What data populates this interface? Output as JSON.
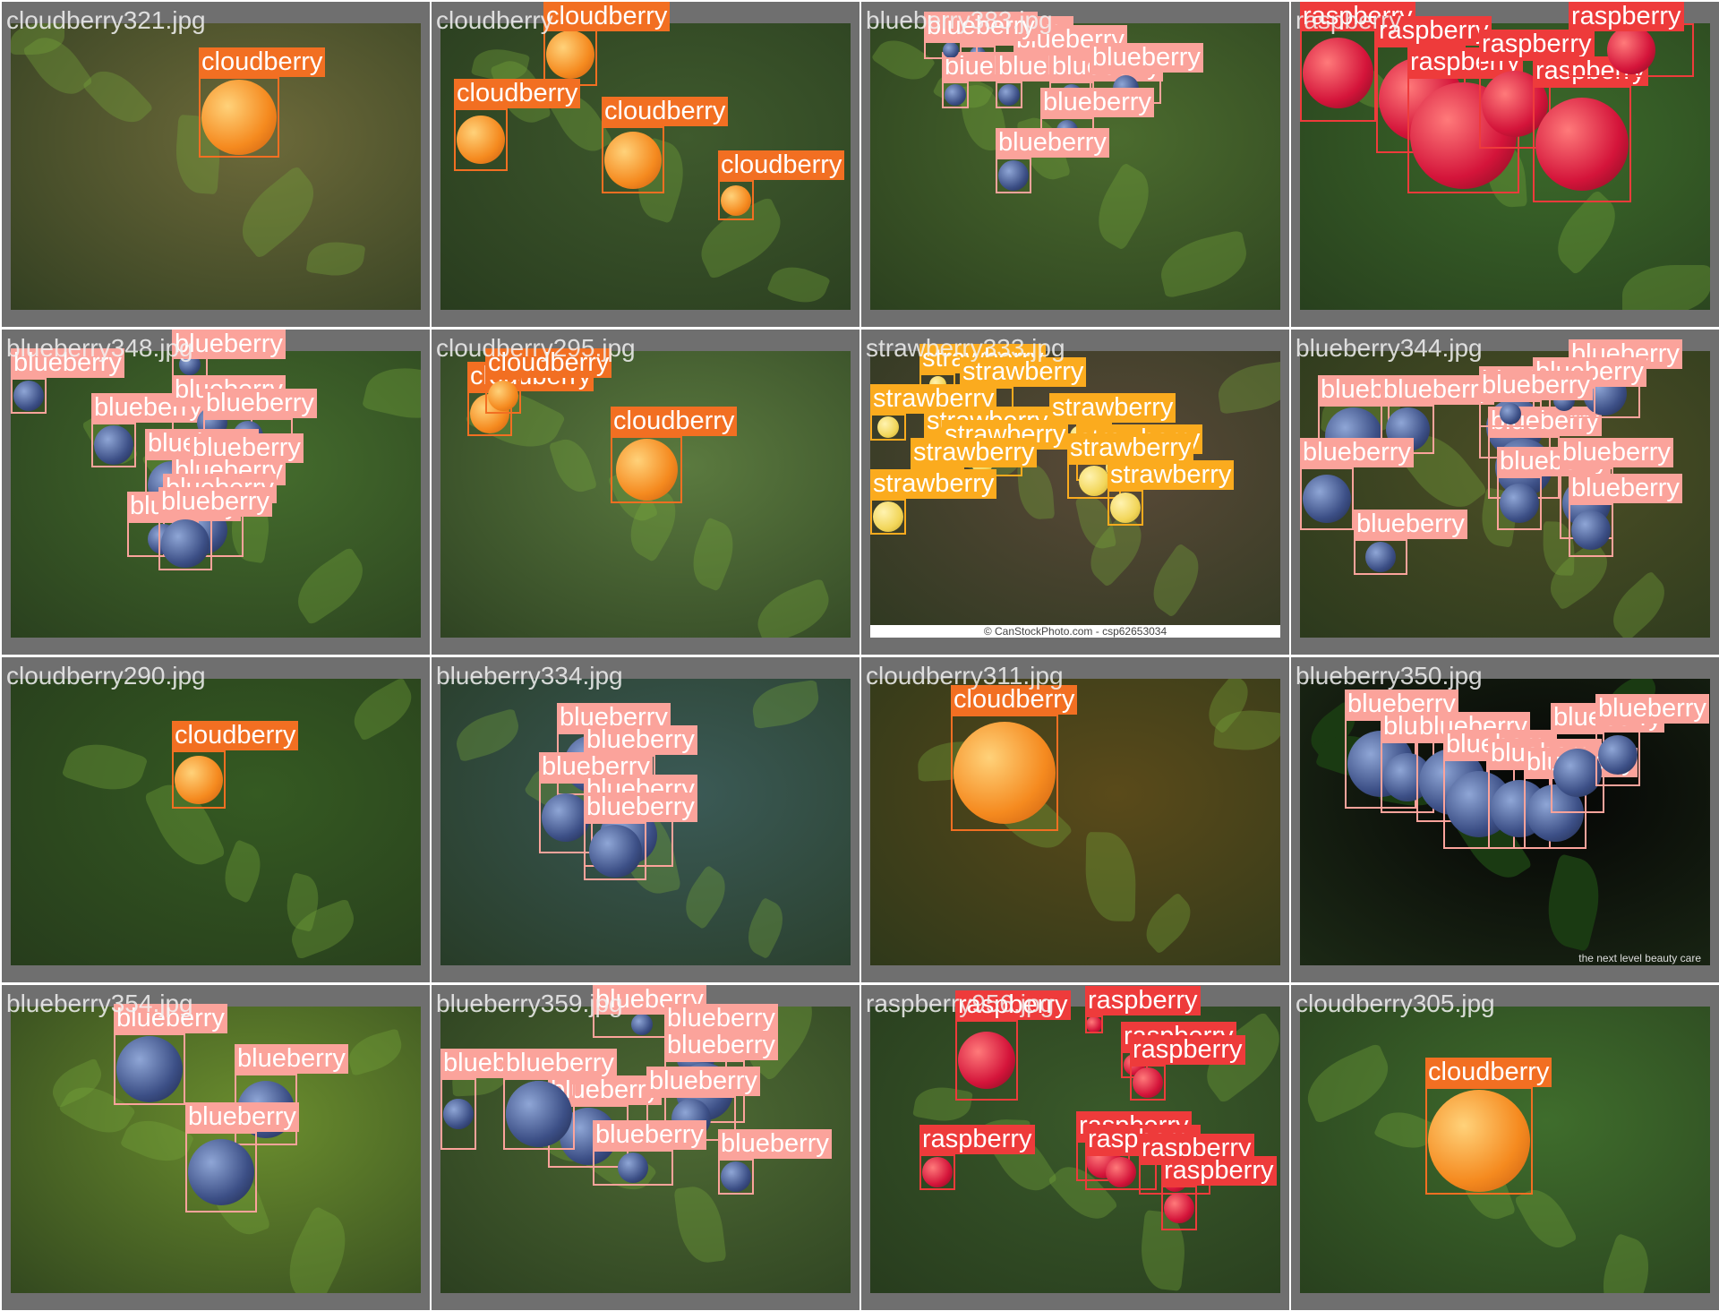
{
  "colors": {
    "cloudberry": "#f26f22",
    "blueberry": "#fba39b",
    "raspberry": "#ee3b3b",
    "strawberry": "#fbab1e",
    "tile_bg": "#6f6f6f"
  },
  "tiles": [
    {
      "file": "cloudberry321.jpg",
      "bg": "#6d6a3a",
      "labels": [
        "cloudberry"
      ]
    },
    {
      "file": "cloudberry",
      "bg": "#3f5a2d",
      "labels": [
        "cloudberry",
        "cloudberry",
        "cloudberry",
        "cloudberry"
      ]
    },
    {
      "file": "blueberry383.jpg",
      "bg": "#4b6b2e",
      "labels": [
        "blueberry",
        "blueberry",
        "blueberry",
        "blueberry",
        "blueberry",
        "blueberry",
        "blueberry",
        "blueberry",
        "blueberry"
      ]
    },
    {
      "file": "raspberry",
      "bg": "#3c6a2a",
      "labels": [
        "raspberry",
        "raspberry",
        "raspberry",
        "raspberry",
        "raspberry",
        "raspberry"
      ]
    },
    {
      "file": "blueberry348.jpg",
      "bg": "#456d2d",
      "labels": [
        "blueberry",
        "blueberry",
        "blueberry",
        "blueberry",
        "blueberry",
        "blueberry",
        "blueberry",
        "blueberry",
        "blueberry",
        "blueberry",
        "blueberry"
      ]
    },
    {
      "file": "cloudberry295.jpg",
      "bg": "#5b7a3f",
      "labels": [
        "cloudberry",
        "cloudberry",
        "cloudberry"
      ]
    },
    {
      "file": "strawberry333.jpg",
      "bg": "#5a4a38",
      "labels": [
        "strawberry",
        "strawberry",
        "strawberry",
        "strawberry",
        "strawberry",
        "strawberry",
        "strawberry",
        "strawberry",
        "strawberry",
        "strawberry",
        "strawberry"
      ],
      "watermark": "© CanStockPhoto.com - csp62653034"
    },
    {
      "file": "blueberry344.jpg",
      "bg": "#4d4f26",
      "labels": [
        "blueberry",
        "blueberry",
        "blueberry",
        "blueberry",
        "blueberry",
        "blueberry",
        "blueberry",
        "blueberry",
        "blueberry",
        "blueberry",
        "blueberry",
        "blueberry"
      ]
    },
    {
      "file": "cloudberry290.jpg",
      "bg": "#355a22",
      "labels": [
        "cloudberry"
      ]
    },
    {
      "file": "blueberry334.jpg",
      "bg": "#3b5a56",
      "labels": [
        "blueberry",
        "blueberry",
        "blueberry",
        "blueberry",
        "blueberry"
      ]
    },
    {
      "file": "cloudberry311.jpg",
      "bg": "#5a4a1a",
      "labels": [
        "cloudberry"
      ]
    },
    {
      "file": "blueberry350.jpg",
      "bg": "#050505",
      "labels": [
        "blueberry",
        "blueberry",
        "blueberry",
        "blueberry",
        "blueberry",
        "blueberry",
        "blueberry",
        "blueberry"
      ],
      "watermark": "the next level beauty care"
    },
    {
      "file": "blueberry354.jpg",
      "bg": "#6b8e2e",
      "labels": [
        "blueberry",
        "blueberry",
        "blueberry"
      ]
    },
    {
      "file": "blueberry359.jpg",
      "bg": "#4e6a34",
      "labels": [
        "blueberry",
        "blueberry",
        "blueberry",
        "blueberry",
        "blueberry",
        "blueberry",
        "blueberry",
        "blueberry",
        "blueberry",
        "blueberry",
        "blueberry"
      ]
    },
    {
      "file": "raspberry956.jpg",
      "bg": "#3a5a2a",
      "labels": [
        "raspberry",
        "raspberry",
        "raspberry",
        "raspberry",
        "raspberry",
        "raspberry",
        "raspberry",
        "raspberry",
        "raspberry"
      ]
    },
    {
      "file": "cloudberry305.jpg",
      "bg": "#3f6d2c",
      "labels": [
        "cloudberry"
      ]
    }
  ]
}
